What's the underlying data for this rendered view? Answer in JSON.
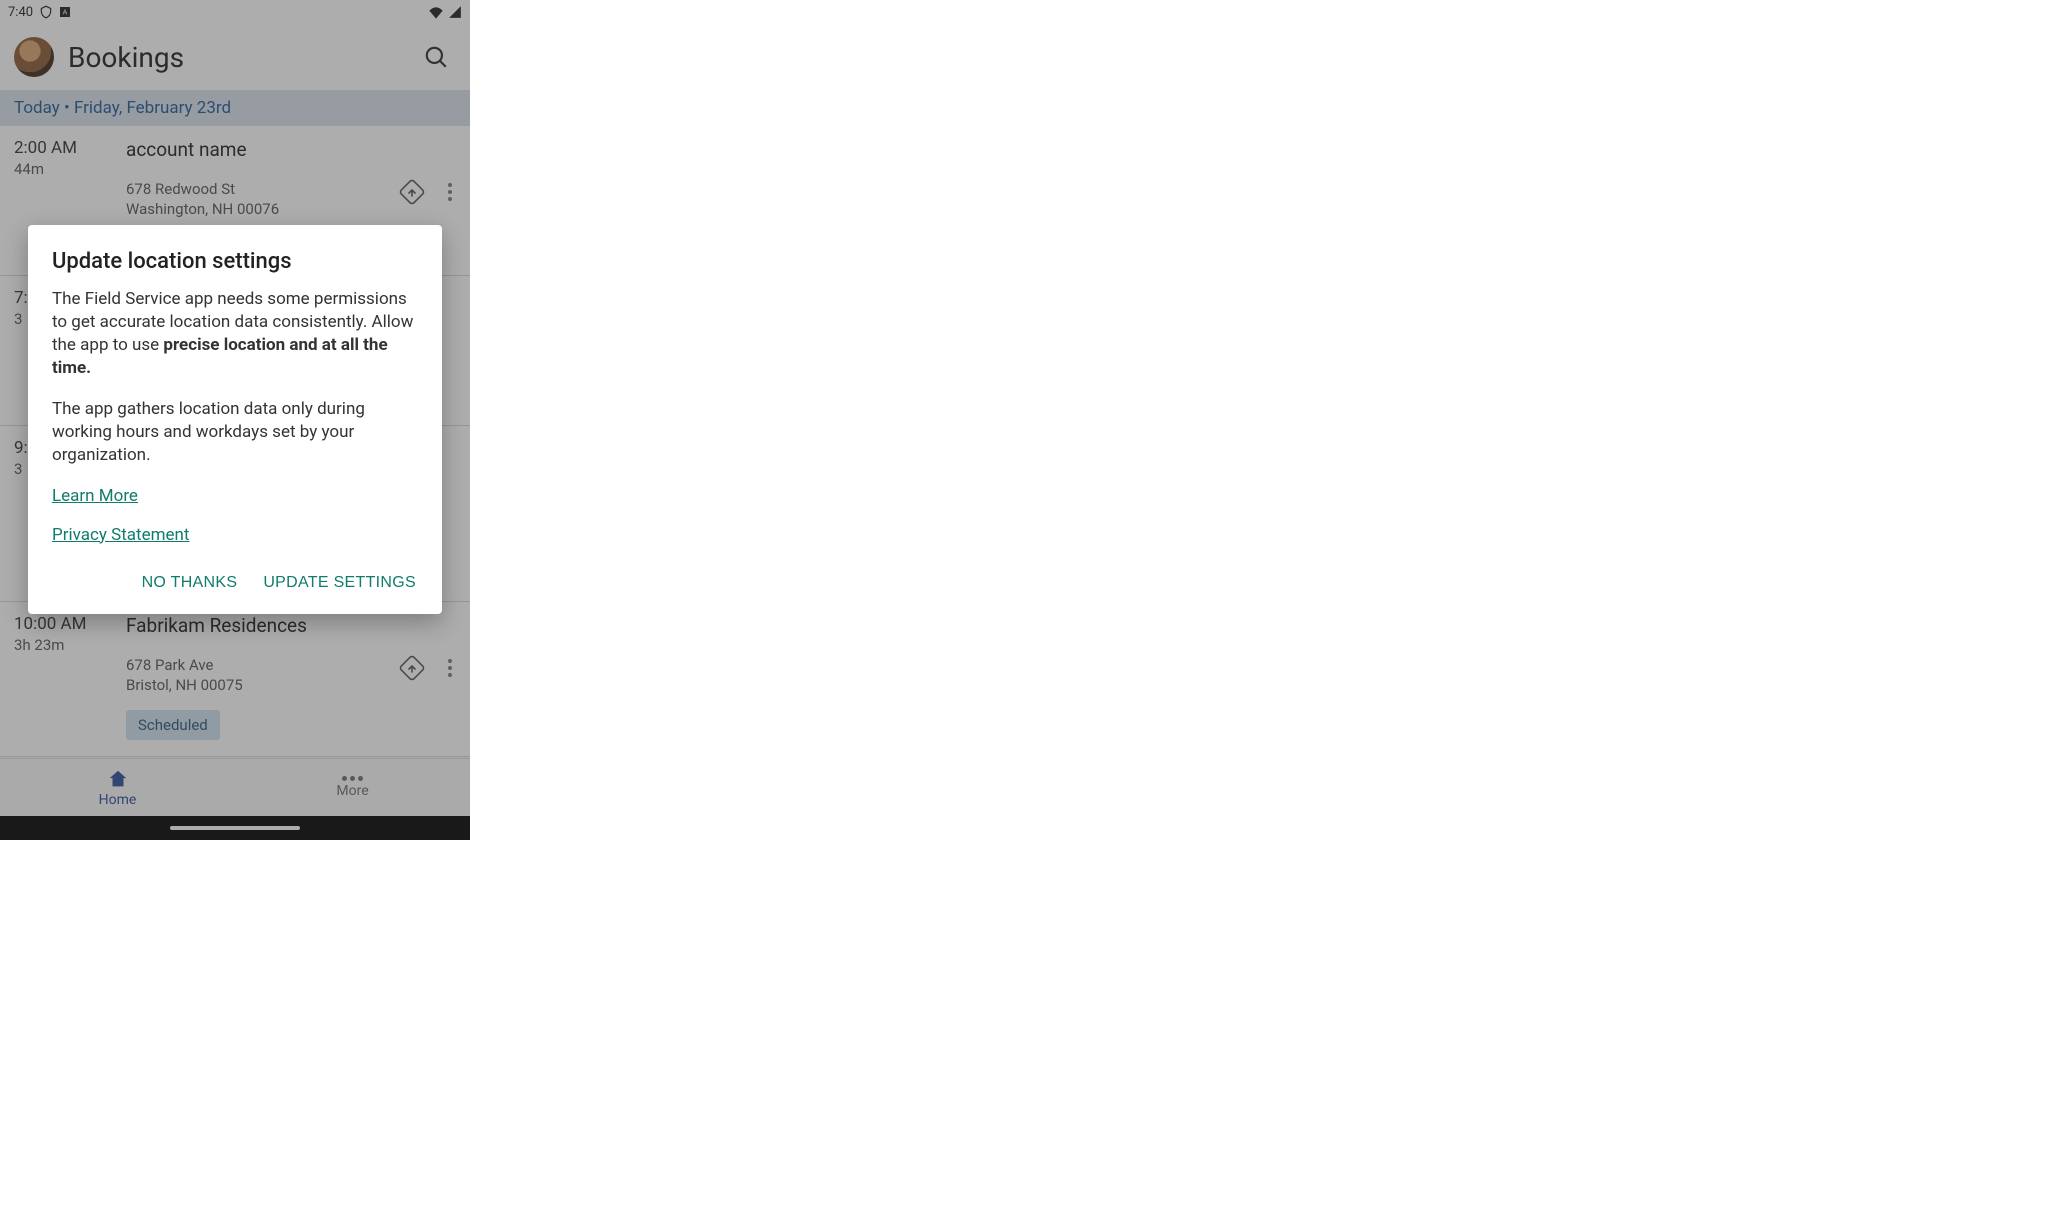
{
  "status_bar": {
    "time": "7:40"
  },
  "header": {
    "title": "Bookings"
  },
  "date_row": "Today • Friday, February 23rd",
  "bookings": [
    {
      "time": "2:00 AM",
      "duration": "44m",
      "account": "account name",
      "addr1": "678 Redwood St",
      "addr2": "Washington, NH 00076"
    },
    {
      "time": "7:",
      "duration": "3",
      "account": "",
      "addr1": "",
      "addr2": ""
    },
    {
      "time": "9:",
      "duration": "3",
      "account": "",
      "addr1": "",
      "addr2": ""
    },
    {
      "time": "10:00 AM",
      "duration": "3h 23m",
      "account": "Fabrikam Residences",
      "addr1": "678 Park Ave",
      "addr2": "Bristol, NH 00075",
      "status": "Scheduled"
    }
  ],
  "bottom_nav": {
    "home": "Home",
    "more": "More"
  },
  "dialog": {
    "title": "Update location settings",
    "body1_a": "The Field Service app needs some permissions to get accurate location data consistently. Allow the app to use ",
    "body1_b": "precise location and at all the time.",
    "body2": "The app gathers location data only during working hours and workdays set by your organization.",
    "learn_more": "Learn More",
    "privacy": "Privacy Statement",
    "no_thanks": "NO THANKS",
    "update": "UPDATE SETTINGS"
  }
}
